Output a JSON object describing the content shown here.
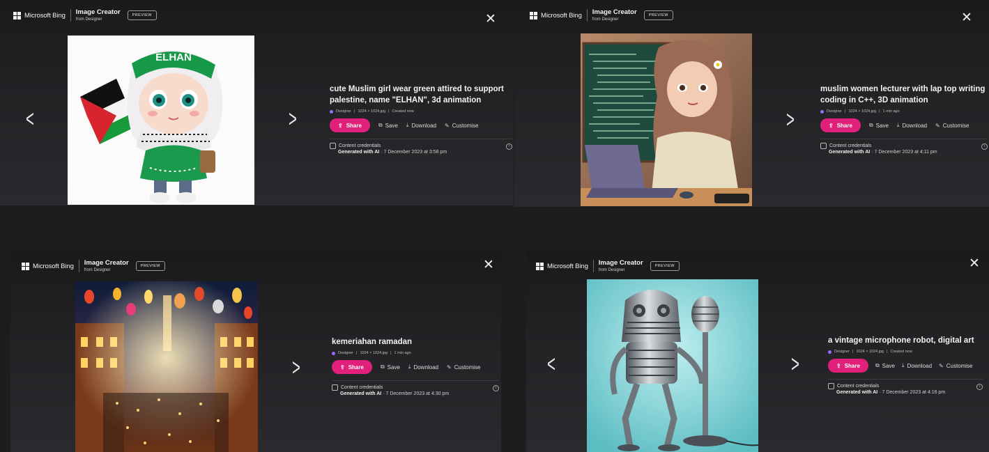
{
  "common": {
    "brand": "Microsoft Bing",
    "app_title": "Image Creator",
    "app_subtitle": "from Designer",
    "preview": "PREVIEW",
    "close": "✕",
    "prev": "<",
    "next": ">",
    "share": "Share",
    "save": "Save",
    "download": "Download",
    "customise": "Customise",
    "content_credentials": "Content credentials",
    "generated": "Generated with AI",
    "designer": "Designer",
    "size": "1024 × 1024.jpg",
    "info": "i"
  },
  "panels": [
    {
      "prompt": "cute Muslim girl wear green attired to support palestine, name \"ELHAN\", 3d animation",
      "created": "Created now",
      "date": " · 7 December 2023 at 3:58 pm",
      "headband_text": "ELHAN"
    },
    {
      "prompt": "muslim women lecturer with lap top writing coding in C++, 3D animation",
      "created": "1 min ago",
      "date": " · 7 December 2023 at 4:11 pm"
    },
    {
      "prompt": "kemeriahan ramadan",
      "created": "1 min ago",
      "date": " · 7 December 2023 at 4:30 pm"
    },
    {
      "prompt": "a vintage microphone robot, digital art",
      "created": "Created now",
      "date": " · 7 December 2023 at 4:16 pm"
    }
  ],
  "colors": {
    "share": "#e0207a",
    "background": "#1e1c1f",
    "panel": "#222225"
  }
}
